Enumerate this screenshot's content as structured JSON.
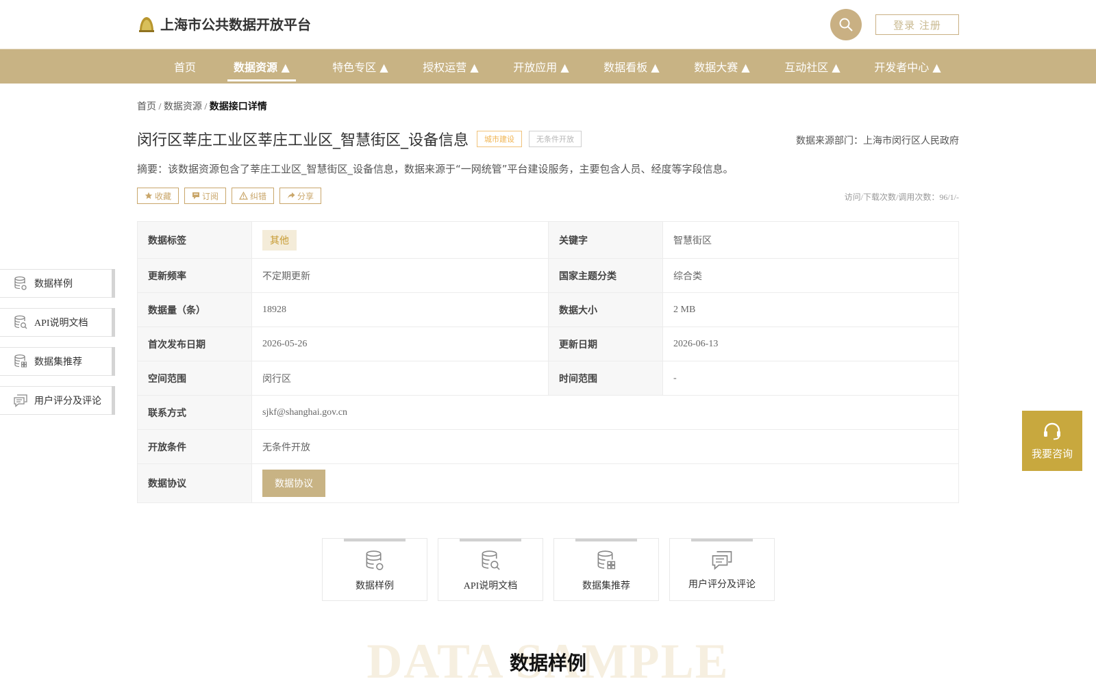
{
  "header": {
    "site_title": "上海市公共数据开放平台",
    "login_label": "登录 注册"
  },
  "nav": {
    "items": [
      {
        "label": "首页"
      },
      {
        "label": "数据资源 ▲"
      },
      {
        "label": "特色专区 ▲"
      },
      {
        "label": "授权运营 ▲"
      },
      {
        "label": "开放应用 ▲"
      },
      {
        "label": "数据看板 ▲"
      },
      {
        "label": "数据大赛 ▲"
      },
      {
        "label": "互动社区 ▲"
      },
      {
        "label": "开发者中心 ▲"
      }
    ]
  },
  "breadcrumb": {
    "home": "首页",
    "sep": "/",
    "section": "数据资源",
    "current": "数据接口详情"
  },
  "detail": {
    "title": "闵行区莘庄工业区莘庄工业区_智慧街区_设备信息",
    "tag_category": "城市建设",
    "tag_open": "无条件开放",
    "source": "数据来源部门：上海市闵行区人民政府",
    "summary": "摘要：该数据资源包含了莘庄工业区_智慧街区_设备信息，数据来源于“一网统管”平台建设服务，主要包含人员、经度等字段信息。",
    "actions": {
      "favorite": "收藏",
      "subscribe": "订阅",
      "report": "纠错",
      "share": "分享"
    },
    "visits": "访问/下载次数/调用次数：96/1/-"
  },
  "table": {
    "tag_label": "数据标签",
    "tag_value": "其他",
    "keyword_label": "关键字",
    "keyword_value": "智慧街区",
    "freq_label": "更新频率",
    "freq_value": "不定期更新",
    "theme_label": "国家主题分类",
    "theme_value": "综合类",
    "count_label": "数据量（条）",
    "count_value": "18928",
    "size_label": "数据大小",
    "size_value": "2 MB",
    "publish_label": "首次发布日期",
    "publish_value": "2026-05-26",
    "update_label": "更新日期",
    "update_value": "2026-06-13",
    "space_label": "空间范围",
    "space_value": "闵行区",
    "time_label": "时间范围",
    "time_value": "-",
    "contact_label": "联系方式",
    "contact_value": "sjkf@shanghai.gov.cn",
    "cond_label": "开放条件",
    "cond_value": "无条件开放",
    "proto_label": "数据协议",
    "proto_button": "数据协议"
  },
  "side_nav": {
    "items": [
      {
        "label": "数据样例",
        "icon": "database-gear-icon"
      },
      {
        "label": "API说明文档",
        "icon": "database-search-icon"
      },
      {
        "label": "数据集推荐",
        "icon": "database-grid-icon"
      },
      {
        "label": "用户评分及评论",
        "icon": "comments-icon"
      }
    ]
  },
  "cards": {
    "items": [
      {
        "label": "数据样例",
        "icon": "database-gear-icon"
      },
      {
        "label": "API说明文档",
        "icon": "database-search-icon"
      },
      {
        "label": "数据集推荐",
        "icon": "database-grid-icon"
      },
      {
        "label": "用户评分及评论",
        "icon": "comments-icon"
      }
    ]
  },
  "consult": {
    "label": "我要咨询",
    "icon": "headset-icon"
  },
  "section": {
    "bg_word": "DATA SAMPLE",
    "title": "数据样例"
  },
  "colors": {
    "brand": "#c8b384",
    "accent_gold": "#c8a83e",
    "tag_orange": "#f0b34f"
  }
}
